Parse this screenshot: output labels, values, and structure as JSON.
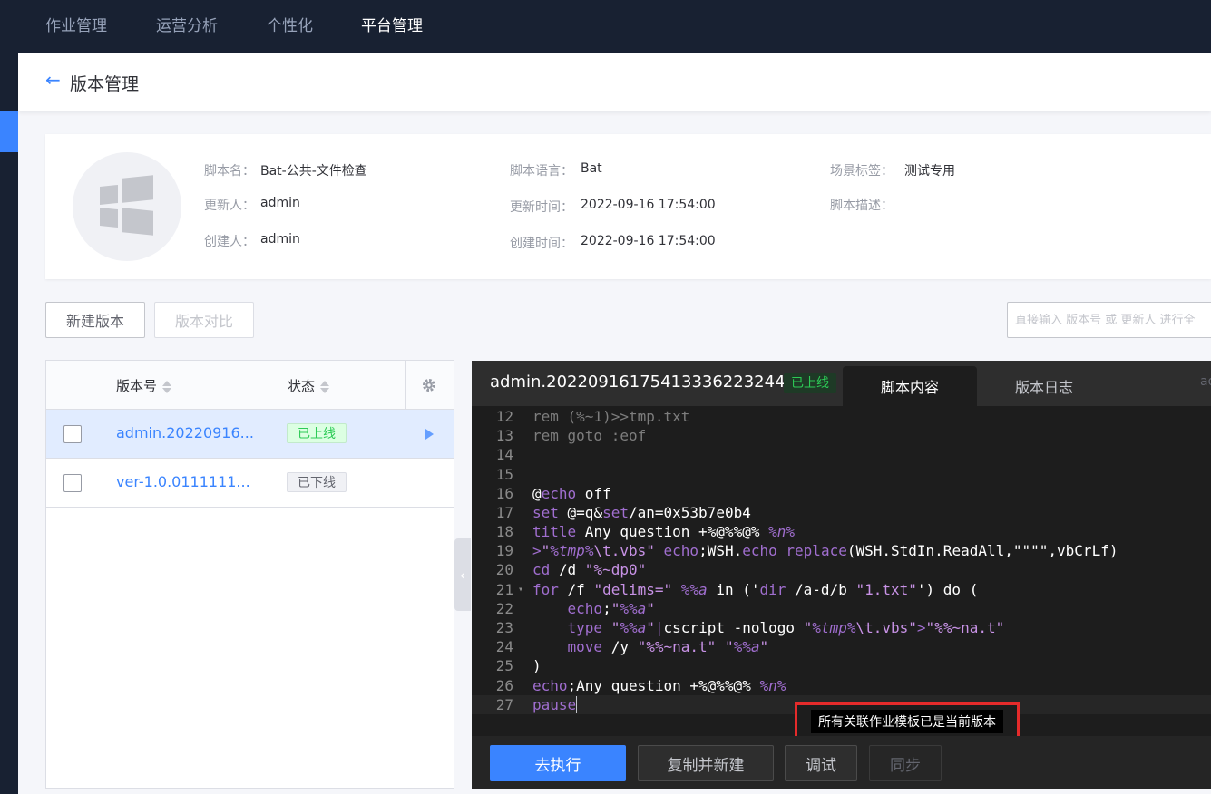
{
  "topnav": [
    "作业管理",
    "运营分析",
    "个性化",
    "平台管理"
  ],
  "header": {
    "title": "版本管理"
  },
  "script_info": {
    "name_label": "脚本名：",
    "name": "Bat-公共-文件检查",
    "language_label": "脚本语言：",
    "language": "Bat",
    "tag_label": "场景标签：",
    "tag": "测试专用",
    "updater_label": "更新人：",
    "updater": "admin",
    "update_time_label": "更新时间：",
    "update_time": "2022-09-16 17:54:00",
    "desc_label": "脚本描述：",
    "creator_label": "创建人：",
    "creator": "admin",
    "create_time_label": "创建时间：",
    "create_time": "2022-09-16 17:54:00"
  },
  "toolbar": {
    "new_version": "新建版本",
    "compare": "版本对比",
    "search_placeholder": "直接输入 版本号 或 更新人 进行全"
  },
  "table": {
    "col_version": "版本号",
    "col_status": "状态",
    "rows": [
      {
        "version": "admin.20220916...",
        "status": "已上线"
      },
      {
        "version": "ver-1.0.0111111...",
        "status": "已下线"
      }
    ]
  },
  "editor": {
    "title": "admin.20220916175413336223244",
    "status": "已上线",
    "tabs": [
      "脚本内容",
      "版本日志"
    ],
    "corner": "ad",
    "tooltip": "所有关联作业模板已是当前版本",
    "lines": [
      12,
      13,
      14,
      15,
      16,
      17,
      18,
      19,
      20,
      21,
      22,
      23,
      24,
      25,
      26,
      27
    ]
  },
  "footer": {
    "execute": "去执行",
    "copy_new": "复制并新建",
    "debug": "调试",
    "sync": "同步"
  },
  "colors": {
    "primary": "#3a84ff",
    "online": "#2dcb56",
    "alert": "#e52b2b"
  }
}
